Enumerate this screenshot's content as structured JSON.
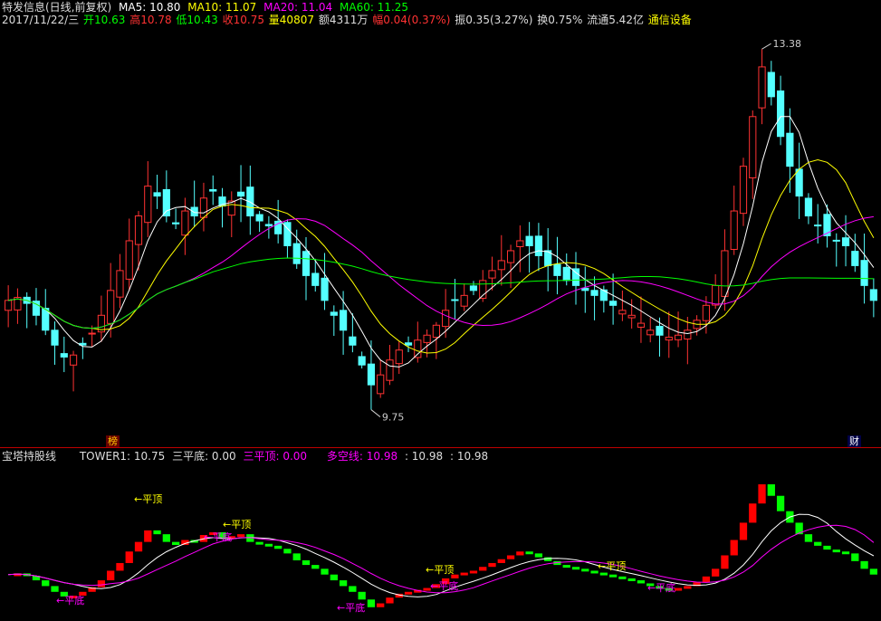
{
  "header": {
    "stock_name": "特发信息(日线,前复权)",
    "ma5_label": "MA5: 10.80",
    "ma10_label": "MA10: 11.07",
    "ma20_label": "MA20: 11.04",
    "ma60_label": "MA60: 11.25",
    "date": "2017/11/22/三",
    "open": "开10.63",
    "high": "高10.78",
    "low": "低10.43",
    "close": "收10.75",
    "volume": "量40807",
    "amount": "额4311万",
    "change": "幅0.04(0.37%)",
    "amplitude": "振0.35(3.27%)",
    "turnover": "换0.75%",
    "float_cap": "流通5.42亿",
    "sector": "通信设备"
  },
  "annotations": {
    "high_price": "13.38",
    "low_price": "9.75",
    "left_badge": "榜",
    "right_badge": "财"
  },
  "indicator": {
    "name": "宝塔持股线",
    "tower1": "TOWER1: 10.75",
    "flat_bottom": "三平底: 0.00",
    "flat_top": "三平顶: 0.00",
    "long_short": "多空线: 10.98",
    "v2": ": 10.98",
    "v3": ": 10.98",
    "flat_top_tag": "←平顶",
    "flat_bottom_tag": "←平底"
  },
  "colors": {
    "up": "#ff3232",
    "down": "#54ffff",
    "ma5": "#ffffff",
    "ma10": "#ffff00",
    "ma20": "#ff00ff",
    "ma60": "#00ff00",
    "tower_up": "#ff0000",
    "tower_down": "#00ff00",
    "flat_top": "#ffff00",
    "flat_bottom": "#ff00ff"
  },
  "chart_data": {
    "type": "candlestick",
    "price_range": [
      9.75,
      13.38
    ],
    "closes": [
      10.85,
      10.88,
      10.82,
      10.7,
      10.55,
      10.4,
      10.28,
      10.3,
      10.4,
      10.52,
      10.7,
      10.95,
      11.15,
      11.45,
      11.7,
      12.0,
      11.9,
      11.7,
      11.62,
      11.75,
      11.7,
      11.88,
      11.95,
      11.8,
      11.85,
      11.9,
      11.7,
      11.65,
      11.6,
      11.52,
      11.4,
      11.22,
      11.1,
      11.0,
      10.85,
      10.7,
      10.55,
      10.4,
      10.2,
      10.0,
      10.1,
      10.25,
      10.35,
      10.4,
      10.45,
      10.5,
      10.6,
      10.75,
      10.85,
      10.9,
      10.95,
      11.05,
      11.15,
      11.25,
      11.35,
      11.45,
      11.4,
      11.3,
      11.2,
      11.1,
      11.05,
      11.0,
      10.95,
      10.9,
      10.85,
      10.8,
      10.75,
      10.7,
      10.62,
      10.55,
      10.5,
      10.48,
      10.5,
      10.55,
      10.65,
      10.8,
      11.0,
      11.35,
      11.75,
      12.2,
      12.7,
      13.2,
      12.9,
      12.5,
      12.2,
      11.9,
      11.7,
      11.6,
      11.5,
      11.45,
      11.4,
      11.2,
      11.0,
      10.85
    ]
  }
}
